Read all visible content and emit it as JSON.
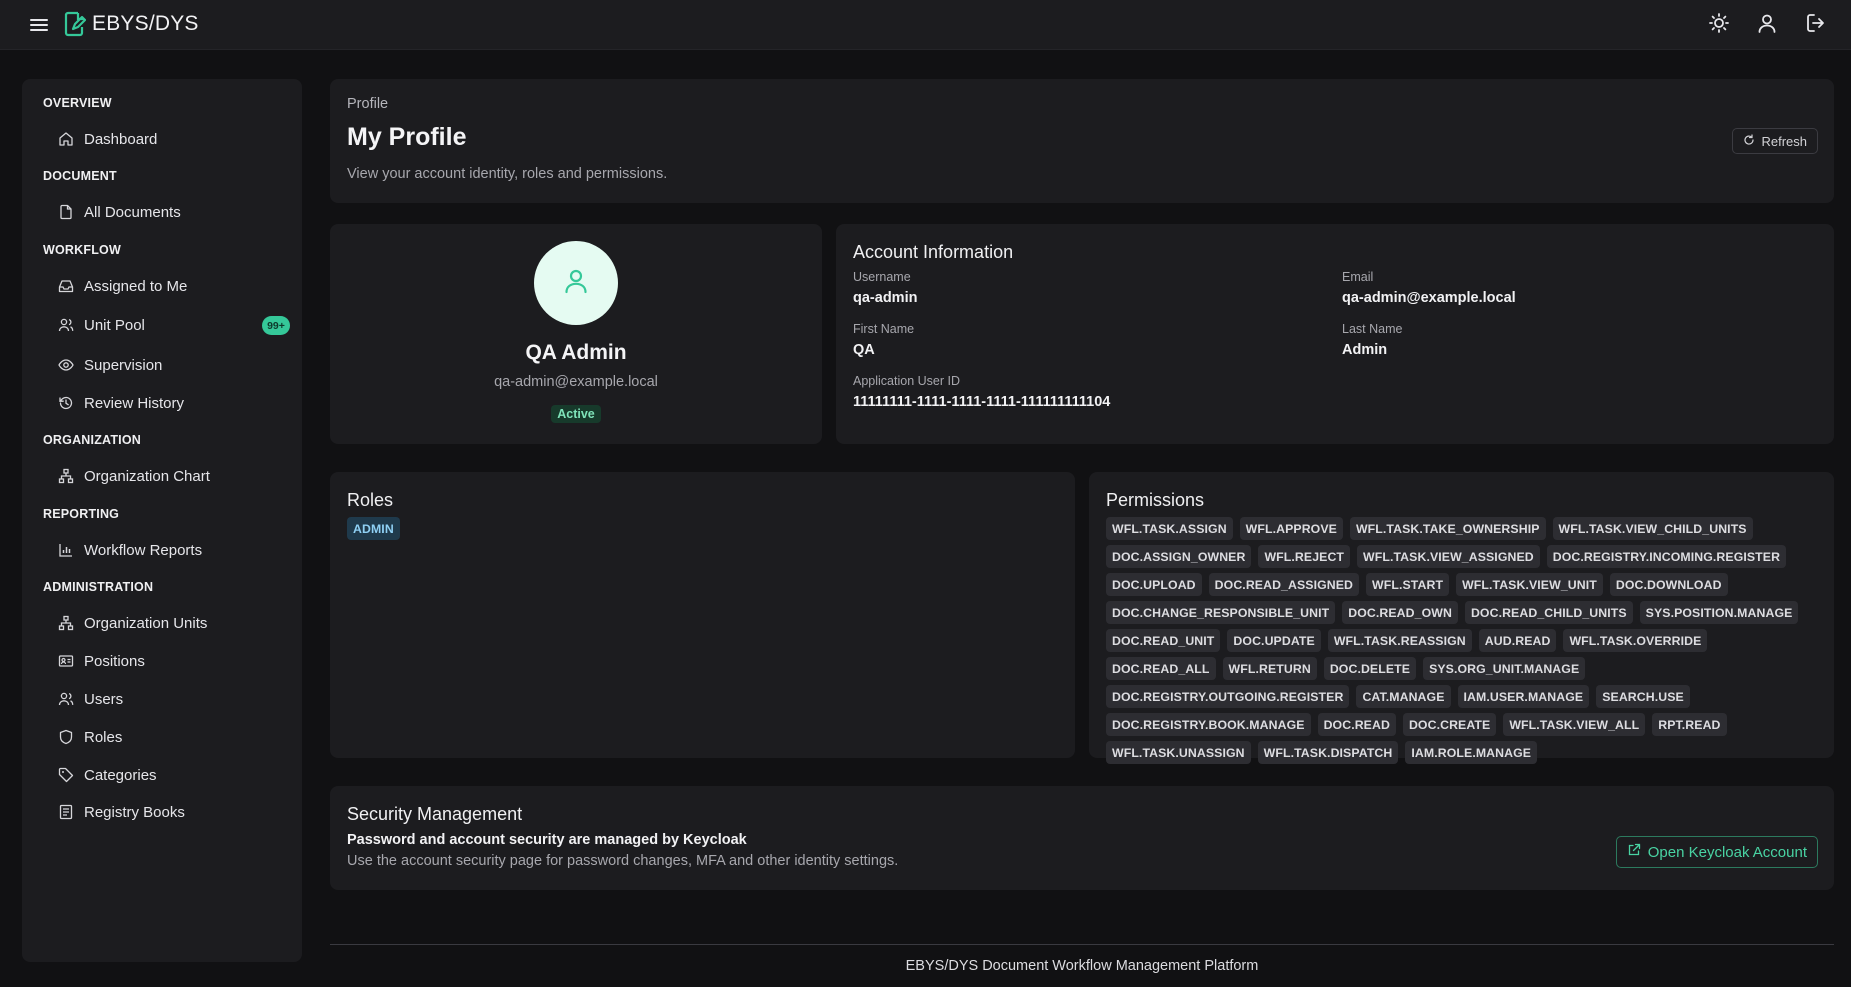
{
  "app": {
    "title": "EBYS/DYS"
  },
  "sidebar": {
    "sections": [
      {
        "title": "OVERVIEW",
        "items": [
          {
            "label": "Dashboard",
            "icon": "home-icon"
          }
        ]
      },
      {
        "title": "DOCUMENT",
        "items": [
          {
            "label": "All Documents",
            "icon": "file-icon"
          }
        ]
      },
      {
        "title": "WORKFLOW",
        "items": [
          {
            "label": "Assigned to Me",
            "icon": "inbox-icon"
          },
          {
            "label": "Unit Pool",
            "icon": "users-icon",
            "badge": "99+"
          },
          {
            "label": "Supervision",
            "icon": "eye-icon"
          },
          {
            "label": "Review History",
            "icon": "history-icon"
          }
        ]
      },
      {
        "title": "ORGANIZATION",
        "items": [
          {
            "label": "Organization Chart",
            "icon": "network-icon"
          }
        ]
      },
      {
        "title": "REPORTING",
        "items": [
          {
            "label": "Workflow Reports",
            "icon": "bar-chart-icon"
          }
        ]
      },
      {
        "title": "ADMINISTRATION",
        "items": [
          {
            "label": "Organization Units",
            "icon": "network-icon"
          },
          {
            "label": "Positions",
            "icon": "id-card-icon"
          },
          {
            "label": "Users",
            "icon": "users-icon"
          },
          {
            "label": "Roles",
            "icon": "shield-icon"
          },
          {
            "label": "Categories",
            "icon": "tag-icon"
          },
          {
            "label": "Registry Books",
            "icon": "book-icon"
          }
        ]
      }
    ]
  },
  "header": {
    "breadcrumb": "Profile",
    "title": "My Profile",
    "subtitle": "View your account identity, roles and permissions.",
    "refresh_label": "Refresh"
  },
  "profile": {
    "name": "QA Admin",
    "email": "qa-admin@example.local",
    "status": "Active"
  },
  "account": {
    "title": "Account Information",
    "username_label": "Username",
    "username": "qa-admin",
    "email_label": "Email",
    "email": "qa-admin@example.local",
    "first_name_label": "First Name",
    "first_name": "QA",
    "last_name_label": "Last Name",
    "last_name": "Admin",
    "app_user_id_label": "Application User ID",
    "app_user_id": "11111111-1111-1111-1111-111111111104"
  },
  "roles": {
    "title": "Roles",
    "items": [
      "ADMIN"
    ]
  },
  "permissions": {
    "title": "Permissions",
    "items": [
      "WFL.TASK.ASSIGN",
      "WFL.APPROVE",
      "WFL.TASK.TAKE_OWNERSHIP",
      "WFL.TASK.VIEW_CHILD_UNITS",
      "DOC.ASSIGN_OWNER",
      "WFL.REJECT",
      "WFL.TASK.VIEW_ASSIGNED",
      "DOC.REGISTRY.INCOMING.REGISTER",
      "DOC.UPLOAD",
      "DOC.READ_ASSIGNED",
      "WFL.START",
      "WFL.TASK.VIEW_UNIT",
      "DOC.DOWNLOAD",
      "DOC.CHANGE_RESPONSIBLE_UNIT",
      "DOC.READ_OWN",
      "DOC.READ_CHILD_UNITS",
      "SYS.POSITION.MANAGE",
      "DOC.READ_UNIT",
      "DOC.UPDATE",
      "WFL.TASK.REASSIGN",
      "AUD.READ",
      "WFL.TASK.OVERRIDE",
      "DOC.READ_ALL",
      "WFL.RETURN",
      "DOC.DELETE",
      "SYS.ORG_UNIT.MANAGE",
      "DOC.REGISTRY.OUTGOING.REGISTER",
      "CAT.MANAGE",
      "IAM.USER.MANAGE",
      "SEARCH.USE",
      "DOC.REGISTRY.BOOK.MANAGE",
      "DOC.READ",
      "DOC.CREATE",
      "WFL.TASK.VIEW_ALL",
      "RPT.READ",
      "WFL.TASK.UNASSIGN",
      "WFL.TASK.DISPATCH",
      "IAM.ROLE.MANAGE"
    ]
  },
  "security": {
    "title": "Security Management",
    "strong": "Password and account security are managed by Keycloak",
    "text": "Use the account security page for password changes, MFA and other identity settings.",
    "button_label": "Open Keycloak Account"
  },
  "footer": {
    "text": "EBYS/DYS Document Workflow Management Platform"
  },
  "colors": {
    "accent": "#35c899",
    "background": "#111113",
    "card": "#1c1c1f"
  }
}
